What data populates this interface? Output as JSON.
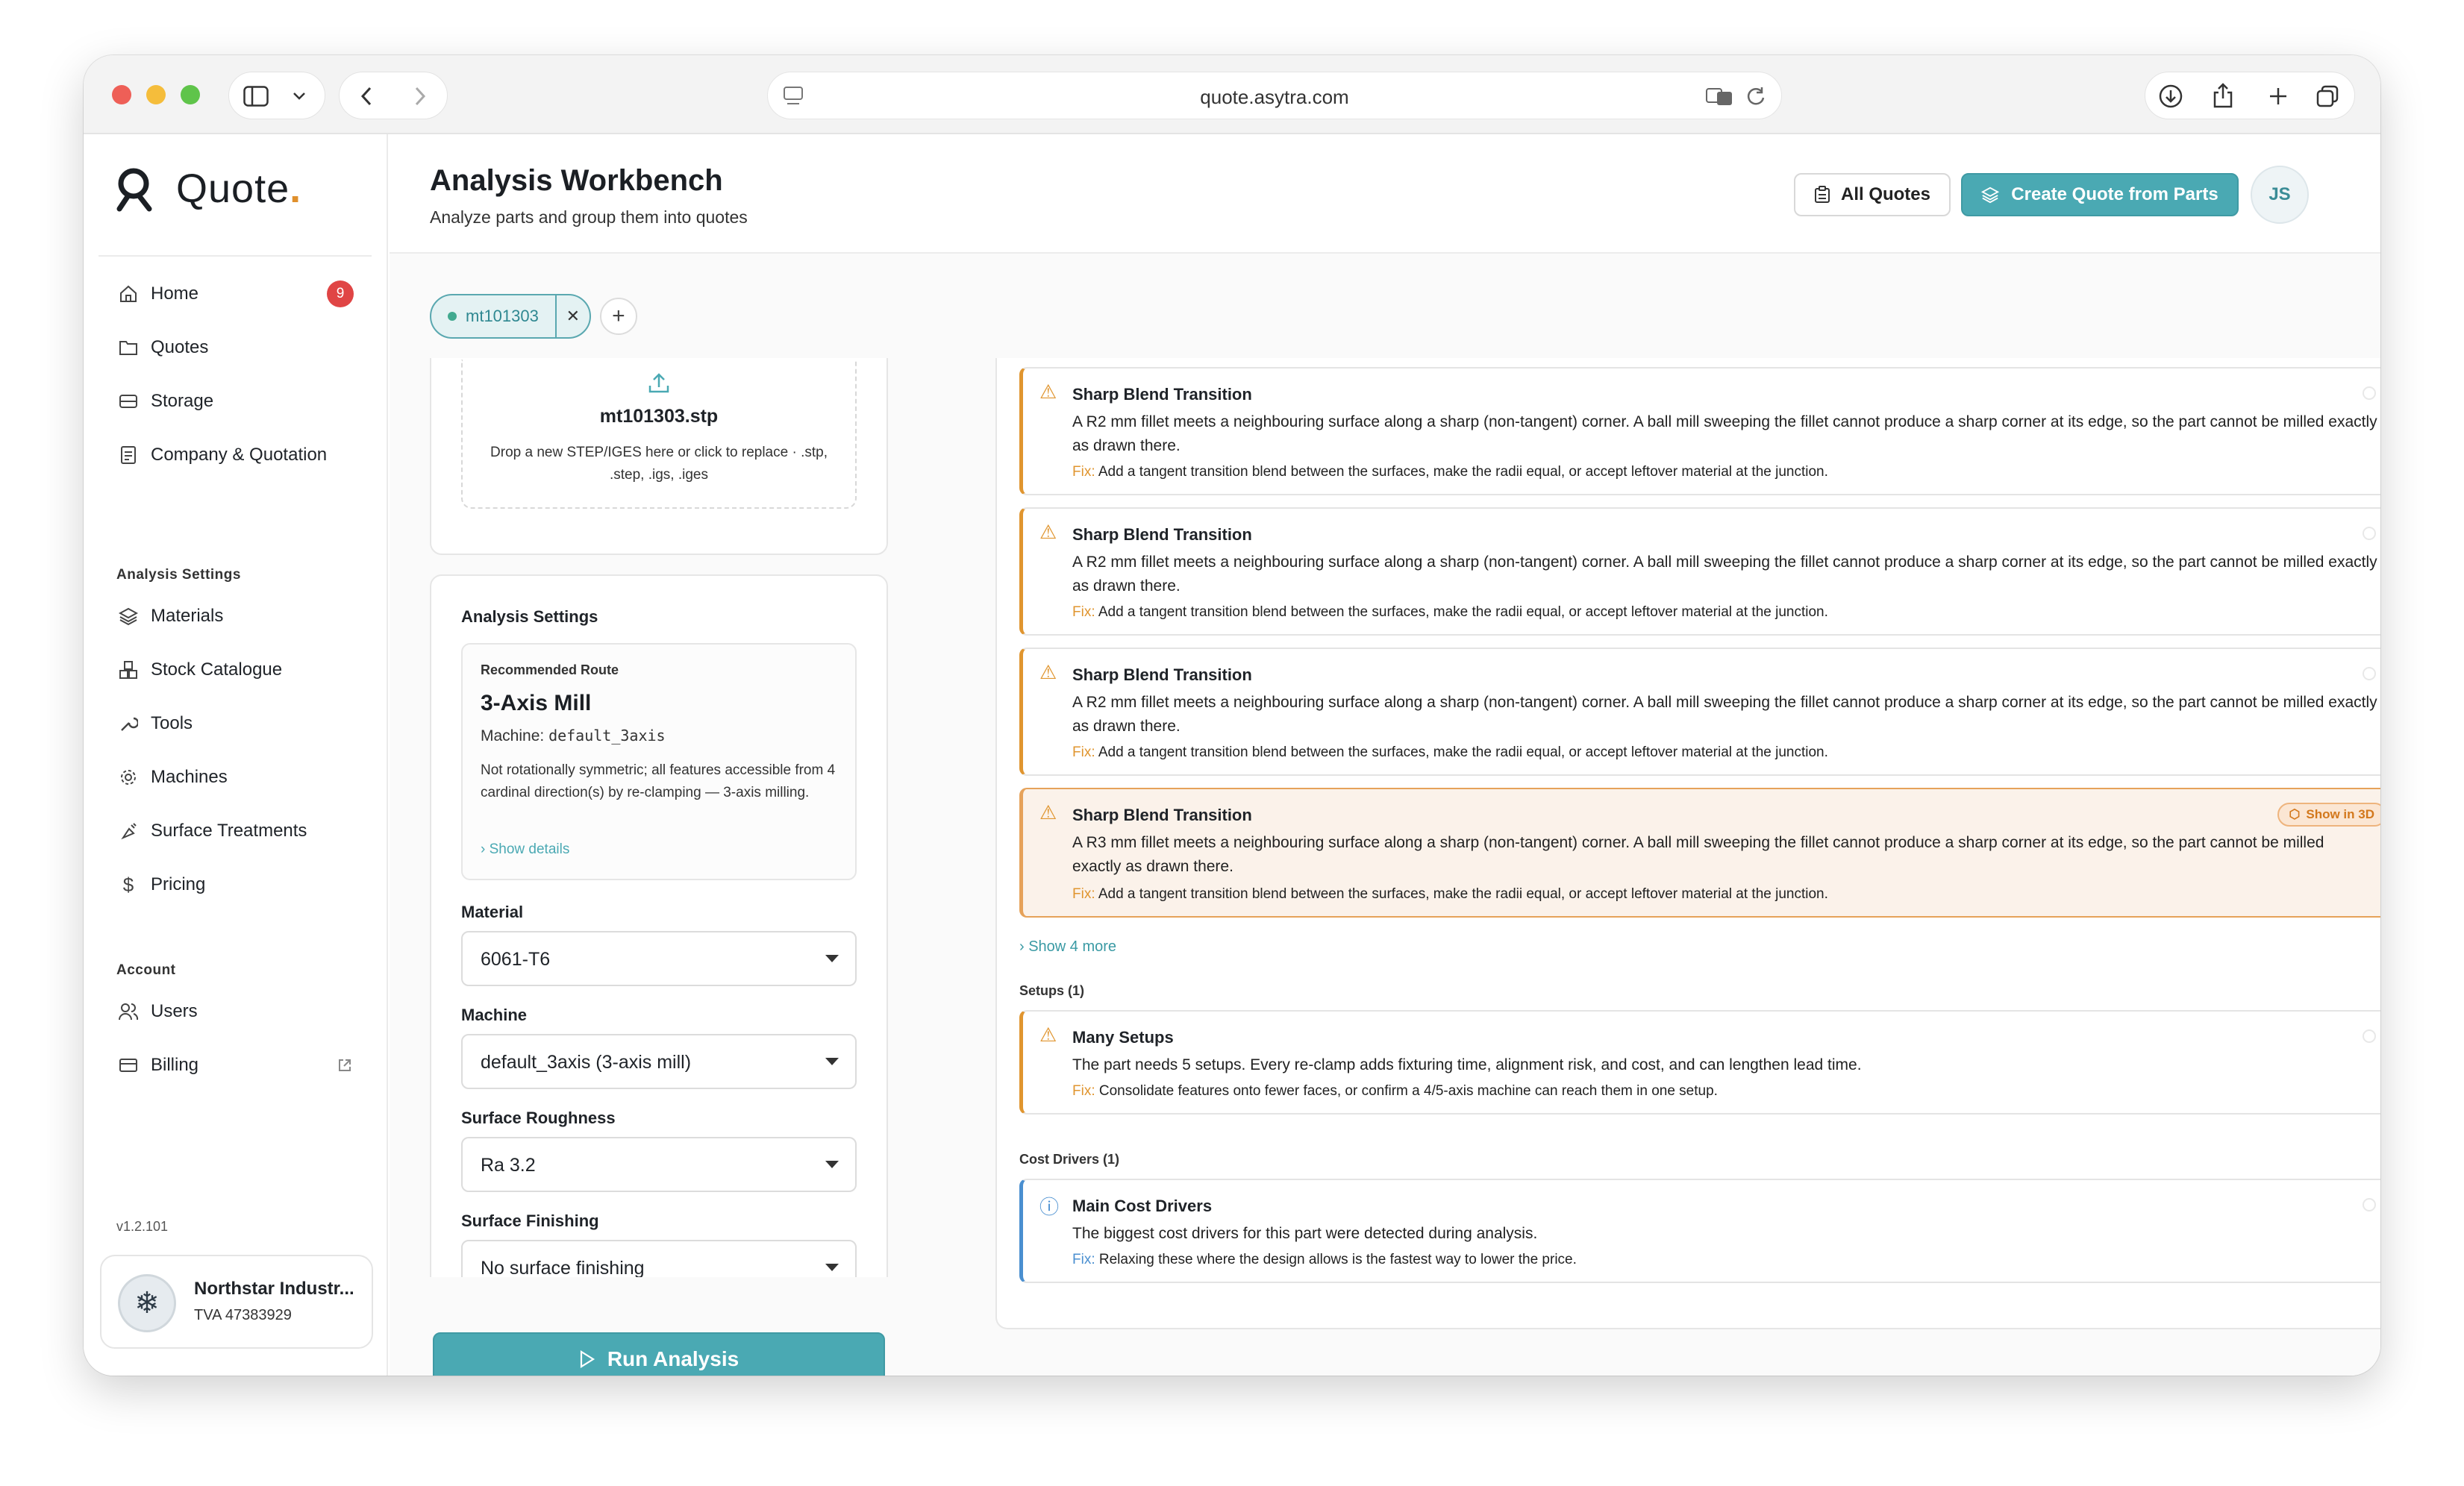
{
  "browser": {
    "url": "quote.asytra.com"
  },
  "brand": {
    "name": "Quote",
    "accent": "#4aa9b3",
    "warning": "#e0952f",
    "info": "#4a8fd0"
  },
  "sidebar": {
    "main_items": [
      {
        "label": "Home",
        "icon": "home-icon",
        "badge": "9"
      },
      {
        "label": "Quotes",
        "icon": "folder-icon"
      },
      {
        "label": "Storage",
        "icon": "storage-icon"
      },
      {
        "label": "Company & Quotation",
        "icon": "document-icon"
      }
    ],
    "analysis_heading": "Analysis Settings",
    "analysis_items": [
      {
        "label": "Materials",
        "icon": "layers-icon"
      },
      {
        "label": "Stock Catalogue",
        "icon": "boxes-icon"
      },
      {
        "label": "Tools",
        "icon": "wrench-icon"
      },
      {
        "label": "Machines",
        "icon": "gear-icon"
      },
      {
        "label": "Surface Treatments",
        "icon": "spray-icon"
      },
      {
        "label": "Pricing",
        "icon": "dollar-icon"
      }
    ],
    "account_heading": "Account",
    "account_items": [
      {
        "label": "Users",
        "icon": "users-icon"
      },
      {
        "label": "Billing",
        "icon": "card-icon"
      }
    ],
    "version": "v1.2.101",
    "company": {
      "name": "Northstar Industr...",
      "tva": "TVA 47383929"
    }
  },
  "header": {
    "title": "Analysis Workbench",
    "subtitle": "Analyze parts and group them into quotes",
    "all_quotes": "All Quotes",
    "create_quote": "Create Quote from Parts",
    "avatar": "JS"
  },
  "tabs": [
    {
      "label": "mt101303"
    }
  ],
  "upload": {
    "filename": "mt101303.stp",
    "hint": "Drop a new STEP/IGES here or click to replace · .stp, .step, .igs, .iges"
  },
  "settings": {
    "heading": "Analysis Settings",
    "route_label": "Recommended Route",
    "route_name": "3-Axis Mill",
    "machine_prefix": "Machine:",
    "machine_code": "default_3axis",
    "route_desc": "Not rotationally symmetric; all features accessible from 4 cardinal direction(s) by re-clamping — 3-axis milling.",
    "show_details": "Show details",
    "material_label": "Material",
    "material_value": "6061-T6",
    "machine_label": "Machine",
    "machine_value": "default_3axis (3-axis mill)",
    "roughness_label": "Surface Roughness",
    "roughness_value": "Ra 3.2",
    "finishing_label": "Surface Finishing",
    "finishing_value": "No surface finishing",
    "run": "Run Analysis"
  },
  "issues": [
    {
      "title": "Sharp Blend Transition",
      "desc": "A R2 mm fillet meets a neighbouring surface along a sharp (non-tangent) corner. A ball mill sweeping the fillet cannot produce a sharp corner at its edge, so the part cannot be milled exactly as drawn there.",
      "fix_label": "Fix:",
      "fix": "Add a tangent transition blend between the surfaces, make the radii equal, or accept leftover material at the junction."
    },
    {
      "title": "Sharp Blend Transition",
      "desc": "A R2 mm fillet meets a neighbouring surface along a sharp (non-tangent) corner. A ball mill sweeping the fillet cannot produce a sharp corner at its edge, so the part cannot be milled exactly as drawn there.",
      "fix_label": "Fix:",
      "fix": "Add a tangent transition blend between the surfaces, make the radii equal, or accept leftover material at the junction."
    },
    {
      "title": "Sharp Blend Transition",
      "desc": "A R2 mm fillet meets a neighbouring surface along a sharp (non-tangent) corner. A ball mill sweeping the fillet cannot produce a sharp corner at its edge, so the part cannot be milled exactly as drawn there.",
      "fix_label": "Fix:",
      "fix": "Add a tangent transition blend between the surfaces, make the radii equal, or accept leftover material at the junction."
    },
    {
      "title": "Sharp Blend Transition",
      "desc": "A R3 mm fillet meets a neighbouring surface along a sharp (non-tangent) corner. A ball mill sweeping the fillet cannot produce a sharp corner at its edge, so the part cannot be milled exactly as drawn there.",
      "fix_label": "Fix:",
      "fix": "Add a tangent transition blend between the surfaces, make the radii equal, or accept leftover material at the junction.",
      "show3d": "Show in 3D"
    }
  ],
  "show_more": "Show 4 more",
  "setups": {
    "heading": "Setups (1)",
    "title": "Many Setups",
    "desc": "The part needs 5 setups. Every re-clamp adds fixturing time, alignment risk, and cost, and can lengthen lead time.",
    "fix_label": "Fix:",
    "fix": "Consolidate features onto fewer faces, or confirm a 4/5-axis machine can reach them in one setup."
  },
  "cost": {
    "heading": "Cost Drivers (1)",
    "title": "Main Cost Drivers",
    "desc": "The biggest cost drivers for this part were detected during analysis.",
    "fix_label": "Fix:",
    "fix": "Relaxing these where the design allows is the fastest way to lower the price."
  }
}
